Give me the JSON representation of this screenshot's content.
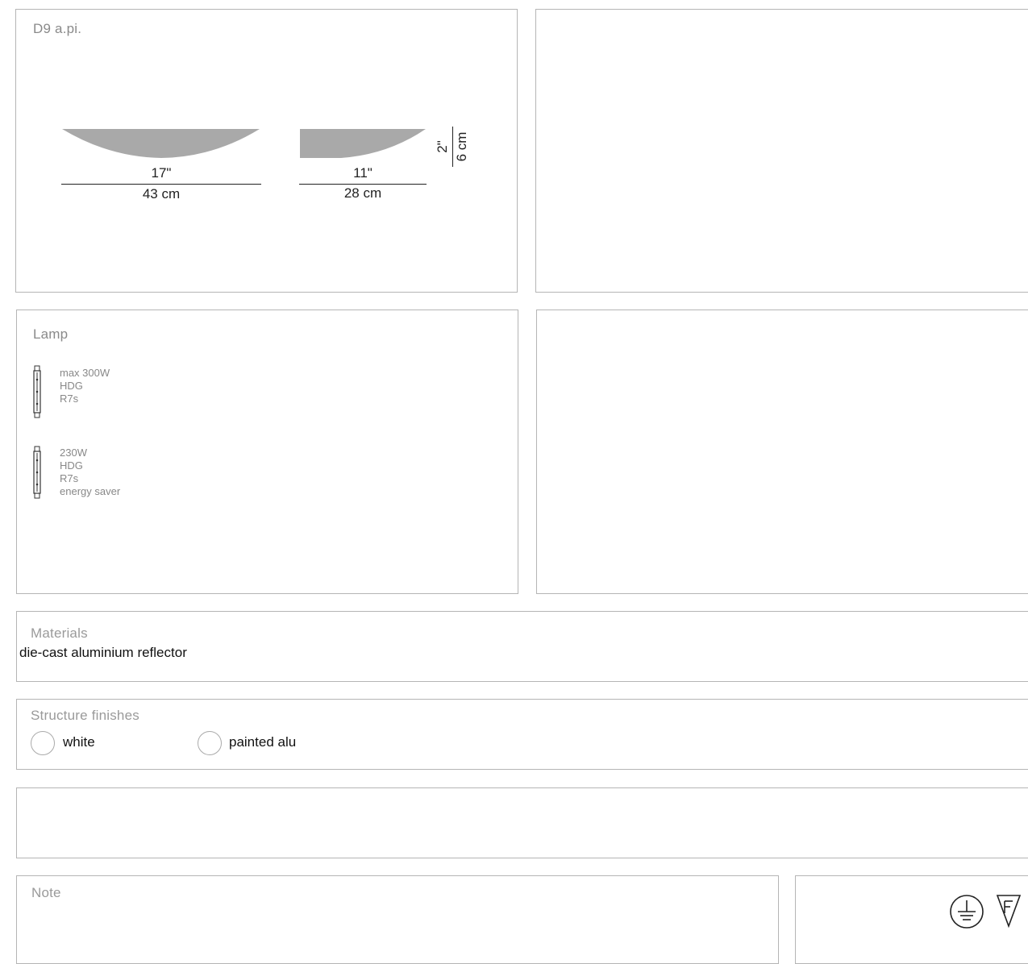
{
  "product": {
    "title": "D9 a.pi.",
    "dimensions": {
      "large_width_in": "17\"",
      "large_width_cm": "43 cm",
      "small_width_in": "11\"",
      "small_width_cm": "28 cm",
      "height_in": "2\"",
      "height_cm": "6 cm"
    }
  },
  "lamp": {
    "title": "Lamp",
    "options": [
      {
        "lines": [
          "max 300W",
          "HDG",
          "R7s"
        ],
        "icon": "halogen-tube-icon"
      },
      {
        "lines": [
          "230W",
          "HDG",
          "R7s",
          "energy saver"
        ],
        "icon": "halogen-tube-icon"
      }
    ]
  },
  "materials": {
    "title": "Materials",
    "value": "die-cast aluminium reflector"
  },
  "finishes": {
    "title": "Structure finishes",
    "options": [
      "white",
      "painted alu"
    ]
  },
  "note": {
    "title": "Note"
  },
  "icons": {
    "ground": "ground-symbol-icon",
    "f_mark": "f-mark-icon"
  }
}
